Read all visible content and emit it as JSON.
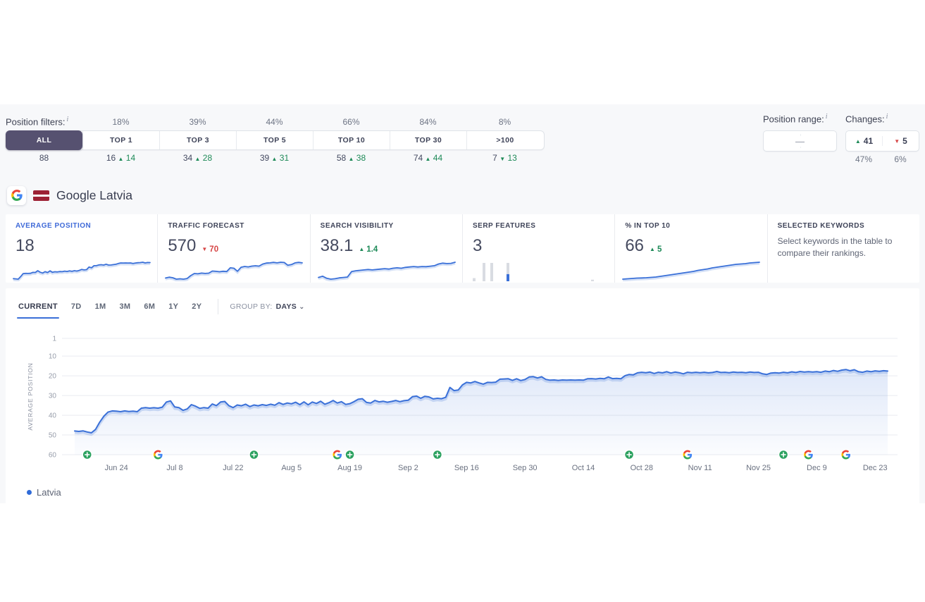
{
  "icons": {
    "up_arrow": "▲",
    "down_arrow": "▼",
    "caret": "⌄",
    "info": "i",
    "dash": "—"
  },
  "filters": {
    "label": "Position filters:",
    "tabs": [
      {
        "label": "ALL",
        "pct": "",
        "count": "88",
        "change": "",
        "dir": "none",
        "active": true
      },
      {
        "label": "TOP 1",
        "pct": "18%",
        "count": "16",
        "change": "14",
        "dir": "up"
      },
      {
        "label": "TOP 3",
        "pct": "39%",
        "count": "34",
        "change": "28",
        "dir": "up"
      },
      {
        "label": "TOP 5",
        "pct": "44%",
        "count": "39",
        "change": "31",
        "dir": "up"
      },
      {
        "label": "TOP 10",
        "pct": "66%",
        "count": "58",
        "change": "38",
        "dir": "up"
      },
      {
        "label": "TOP 30",
        "pct": "84%",
        "count": "74",
        "change": "44",
        "dir": "up"
      },
      {
        "label": ">100",
        "pct": "8%",
        "count": "7",
        "change": "13",
        "dir": "down"
      }
    ]
  },
  "position_range": {
    "label": "Position range:",
    "value": "—"
  },
  "changes": {
    "label": "Changes:",
    "up_value": "41",
    "down_value": "5",
    "up_pct": "47%",
    "down_pct": "6%"
  },
  "project": {
    "title": "Google Latvia",
    "search_engine": "Google",
    "flag": "Latvia"
  },
  "cards": [
    {
      "title": "AVERAGE POSITION",
      "value": "18",
      "active": true,
      "spark": [
        48,
        48.5,
        49,
        44,
        38.5,
        38,
        38.2,
        37.9,
        36.2,
        36.3,
        33,
        35.9,
        37.4,
        34.8,
        36.4,
        33.2,
        36,
        34.9,
        35.3,
        34.5,
        34.8,
        33.8,
        34.4,
        33.3,
        34.2,
        32.9,
        33.6,
        32.4,
        30.5,
        31.5,
        30.9,
        26,
        27.4,
        23.4,
        23.5,
        22,
        21.6,
        22.3,
        20.6,
        22.2,
        22.1,
        21.5,
        20.8,
        19.3,
        18.3,
        18.4,
        18.2,
        18.4,
        18.2,
        19.2,
        18.4,
        17.9,
        17.6,
        16.9,
        18.2,
        17.5,
        17.6
      ],
      "invert": true
    },
    {
      "title": "TRAFFIC FORECAST",
      "value": "570",
      "change": "70",
      "dir": "down",
      "spark": [
        390,
        405,
        395,
        372,
        378,
        372,
        382,
        430,
        465,
        460,
        472,
        466,
        470,
        505,
        500,
        494,
        502,
        497,
        558,
        552,
        502,
        568,
        580,
        574,
        586,
        592,
        586,
        620,
        636,
        640,
        648,
        640,
        650,
        645,
        600,
        612,
        640,
        648,
        640
      ],
      "invert": false
    },
    {
      "title": "SEARCH VISIBILITY",
      "value": "38.1",
      "change": "1.4",
      "dir": "up",
      "spark": [
        20,
        21.5,
        19,
        18,
        18.5,
        19.5,
        20,
        20.5,
        27,
        28,
        28.5,
        29,
        29.5,
        29,
        29.5,
        30,
        30.5,
        30,
        31,
        31.5,
        31,
        32,
        32.5,
        33,
        32.5,
        33,
        32.8,
        33.4,
        34,
        36,
        37,
        36.5,
        36.8,
        38.1
      ],
      "invert": false
    },
    {
      "title": "SERP FEATURES",
      "value": "3",
      "bars": [
        {
          "x": 0.03,
          "h": 0.16
        },
        {
          "x": 0.1,
          "h": 0.93
        },
        {
          "x": 0.155,
          "h": 0.93
        },
        {
          "x": 0.27,
          "h": 0.93,
          "blue": 0.36
        },
        {
          "x": 0.87,
          "h": 0.08
        }
      ]
    },
    {
      "title": "% IN TOP 10",
      "value": "66",
      "change": "5",
      "dir": "up",
      "spark": [
        18,
        19,
        20,
        21,
        21.5,
        22,
        23,
        24,
        26,
        28,
        30,
        32,
        34,
        36,
        38,
        40,
        43,
        45,
        47,
        50,
        52,
        54,
        56,
        58,
        60,
        61,
        62,
        64,
        65,
        66
      ],
      "invert": false
    },
    {
      "title": "SELECTED KEYWORDS",
      "text": "Select keywords in the table to compare their rankings."
    }
  ],
  "period_tabs": [
    "CURRENT",
    "7D",
    "1M",
    "3M",
    "6M",
    "1Y",
    "2Y"
  ],
  "group_by": {
    "label": "GROUP BY:",
    "value": "DAYS"
  },
  "chart_data": {
    "type": "line",
    "title": "Average position trend",
    "ylabel": "AVERAGE POSITION",
    "y_ticks": [
      1,
      10,
      20,
      30,
      40,
      50,
      60
    ],
    "ylim": [
      1,
      60
    ],
    "y_inverted": true,
    "grid": "horizontal",
    "x_tick_days": [
      10,
      24,
      38,
      52,
      66,
      80,
      94,
      108,
      122,
      136,
      150,
      164,
      178,
      192
    ],
    "x_tick_labels": [
      "Jun 24",
      "Jul 8",
      "Jul 22",
      "Aug 5",
      "Aug 19",
      "Sep 2",
      "Sep 16",
      "Sep 30",
      "Oct 14",
      "Oct 28",
      "Nov 11",
      "Nov 25",
      "Dec 9",
      "Dec 23"
    ],
    "annotations": [
      {
        "day": 3,
        "type": "note"
      },
      {
        "day": 20,
        "type": "google"
      },
      {
        "day": 43,
        "type": "note"
      },
      {
        "day": 63,
        "type": "google"
      },
      {
        "day": 66,
        "type": "note"
      },
      {
        "day": 87,
        "type": "note"
      },
      {
        "day": 133,
        "type": "note"
      },
      {
        "day": 147,
        "type": "google"
      },
      {
        "day": 170,
        "type": "note"
      },
      {
        "day": 176,
        "type": "google"
      },
      {
        "day": 185,
        "type": "google"
      }
    ],
    "series": [
      {
        "name": "Latvia",
        "color": "#3a70d8",
        "points": [
          [
            0,
            48
          ],
          [
            1,
            48.2
          ],
          [
            2,
            47.9
          ],
          [
            3,
            48.5
          ],
          [
            4,
            48.9
          ],
          [
            5,
            47.2
          ],
          [
            6,
            43.5
          ],
          [
            7,
            40.5
          ],
          [
            8,
            38.4
          ],
          [
            9,
            37.8
          ],
          [
            10,
            37.9
          ],
          [
            11,
            38.2
          ],
          [
            12,
            37.8
          ],
          [
            13,
            38.1
          ],
          [
            14,
            37.9
          ],
          [
            15,
            38.2
          ],
          [
            16,
            36.4
          ],
          [
            17,
            36.1
          ],
          [
            18,
            36.4
          ],
          [
            19,
            36.2
          ],
          [
            20,
            36.4
          ],
          [
            21,
            35.9
          ],
          [
            22,
            33.3
          ],
          [
            23,
            32.7
          ],
          [
            24,
            35.8
          ],
          [
            25,
            36.1
          ],
          [
            26,
            37.5
          ],
          [
            27,
            36.8
          ],
          [
            28,
            34.6
          ],
          [
            29,
            35.4
          ],
          [
            30,
            36.5
          ],
          [
            31,
            36.1
          ],
          [
            32,
            36.4
          ],
          [
            33,
            34.3
          ],
          [
            34,
            35.1
          ],
          [
            35,
            33.3
          ],
          [
            36,
            33.0
          ],
          [
            37,
            35.2
          ],
          [
            38,
            36.1
          ],
          [
            39,
            34.8
          ],
          [
            40,
            35.2
          ],
          [
            41,
            34.4
          ],
          [
            42,
            35.6
          ],
          [
            43,
            34.8
          ],
          [
            44,
            35.2
          ],
          [
            45,
            34.6
          ],
          [
            46,
            35.0
          ],
          [
            47,
            34.4
          ],
          [
            48,
            34.9
          ],
          [
            49,
            33.6
          ],
          [
            50,
            34.5
          ],
          [
            51,
            33.8
          ],
          [
            52,
            34.2
          ],
          [
            53,
            33.4
          ],
          [
            54,
            34.6
          ],
          [
            55,
            33.2
          ],
          [
            56,
            34.7
          ],
          [
            57,
            33.3
          ],
          [
            58,
            34.0
          ],
          [
            59,
            32.9
          ],
          [
            60,
            34.4
          ],
          [
            61,
            33.6
          ],
          [
            62,
            32.5
          ],
          [
            63,
            33.8
          ],
          [
            64,
            33.1
          ],
          [
            65,
            34.5
          ],
          [
            66,
            34.1
          ],
          [
            67,
            33.1
          ],
          [
            68,
            31.9
          ],
          [
            69,
            31.6
          ],
          [
            70,
            33.5
          ],
          [
            71,
            33.8
          ],
          [
            72,
            32.5
          ],
          [
            73,
            33.2
          ],
          [
            74,
            32.9
          ],
          [
            75,
            33.4
          ],
          [
            76,
            33.0
          ],
          [
            77,
            32.5
          ],
          [
            78,
            33.1
          ],
          [
            79,
            32.6
          ],
          [
            80,
            32.4
          ],
          [
            81,
            30.6
          ],
          [
            82,
            30.3
          ],
          [
            83,
            31.4
          ],
          [
            84,
            30.4
          ],
          [
            85,
            30.7
          ],
          [
            86,
            31.7
          ],
          [
            87,
            31.4
          ],
          [
            88,
            31.6
          ],
          [
            89,
            30.9
          ],
          [
            90,
            25.9
          ],
          [
            91,
            27.5
          ],
          [
            92,
            27.2
          ],
          [
            93,
            24.6
          ],
          [
            94,
            23.3
          ],
          [
            95,
            23.6
          ],
          [
            96,
            22.9
          ],
          [
            97,
            23.6
          ],
          [
            98,
            24.2
          ],
          [
            99,
            23.3
          ],
          [
            100,
            23.4
          ],
          [
            101,
            23.2
          ],
          [
            102,
            21.7
          ],
          [
            103,
            21.6
          ],
          [
            104,
            21.5
          ],
          [
            105,
            22.3
          ],
          [
            106,
            21.5
          ],
          [
            107,
            22.4
          ],
          [
            108,
            21.9
          ],
          [
            109,
            20.6
          ],
          [
            110,
            20.4
          ],
          [
            111,
            21.1
          ],
          [
            112,
            20.5
          ],
          [
            113,
            21.8
          ],
          [
            114,
            22.2
          ],
          [
            115,
            22.1
          ],
          [
            116,
            22.3
          ],
          [
            117,
            22.1
          ],
          [
            118,
            22.2
          ],
          [
            119,
            22.1
          ],
          [
            120,
            22.2
          ],
          [
            121,
            22.1
          ],
          [
            122,
            22.2
          ],
          [
            123,
            21.5
          ],
          [
            124,
            21.4
          ],
          [
            125,
            21.6
          ],
          [
            126,
            21.3
          ],
          [
            127,
            21.5
          ],
          [
            128,
            20.6
          ],
          [
            129,
            21.4
          ],
          [
            130,
            21.3
          ],
          [
            131,
            21.5
          ],
          [
            132,
            19.9
          ],
          [
            133,
            19.3
          ],
          [
            134,
            19.5
          ],
          [
            135,
            18.5
          ],
          [
            136,
            18.2
          ],
          [
            137,
            18.4
          ],
          [
            138,
            18.1
          ],
          [
            139,
            18.8
          ],
          [
            140,
            18.2
          ],
          [
            141,
            18.5
          ],
          [
            142,
            17.9
          ],
          [
            143,
            18.6
          ],
          [
            144,
            18.1
          ],
          [
            145,
            18.4
          ],
          [
            146,
            19.0
          ],
          [
            147,
            18.2
          ],
          [
            148,
            18.4
          ],
          [
            149,
            18.2
          ],
          [
            150,
            18.4
          ],
          [
            151,
            18.2
          ],
          [
            152,
            18.5
          ],
          [
            153,
            18.3
          ],
          [
            154,
            17.8
          ],
          [
            155,
            18.3
          ],
          [
            156,
            18.2
          ],
          [
            157,
            18.4
          ],
          [
            158,
            18.1
          ],
          [
            159,
            18.3
          ],
          [
            160,
            18.2
          ],
          [
            161,
            18.4
          ],
          [
            162,
            18.1
          ],
          [
            163,
            18.3
          ],
          [
            164,
            18.2
          ],
          [
            165,
            19.0
          ],
          [
            166,
            19.3
          ],
          [
            167,
            18.6
          ],
          [
            168,
            18.4
          ],
          [
            169,
            18.6
          ],
          [
            170,
            18.2
          ],
          [
            171,
            18.5
          ],
          [
            172,
            18.0
          ],
          [
            173,
            18.3
          ],
          [
            174,
            17.8
          ],
          [
            175,
            18.1
          ],
          [
            176,
            17.9
          ],
          [
            177,
            18.1
          ],
          [
            178,
            17.9
          ],
          [
            179,
            18.2
          ],
          [
            180,
            17.6
          ],
          [
            181,
            17.9
          ],
          [
            182,
            17.3
          ],
          [
            183,
            17.7
          ],
          [
            184,
            17.1
          ],
          [
            185,
            16.8
          ],
          [
            186,
            17.4
          ],
          [
            187,
            16.9
          ],
          [
            188,
            17.9
          ],
          [
            189,
            18.2
          ],
          [
            190,
            17.6
          ],
          [
            191,
            17.9
          ],
          [
            192,
            17.5
          ],
          [
            193,
            17.7
          ],
          [
            194,
            17.4
          ],
          [
            195,
            17.6
          ]
        ]
      }
    ]
  },
  "legend": [
    {
      "label": "Latvia",
      "color": "#2f6bd8"
    }
  ]
}
